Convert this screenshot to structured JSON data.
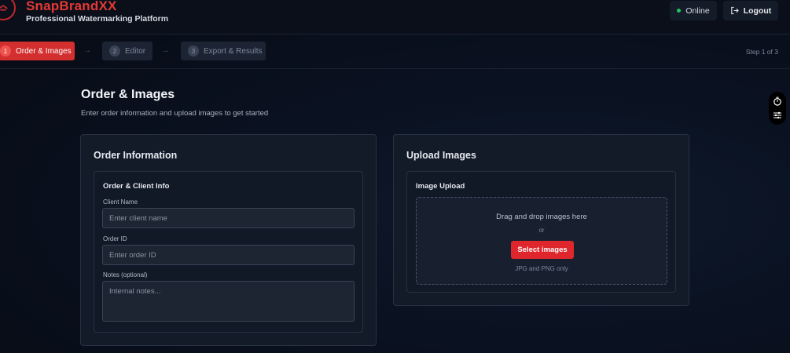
{
  "brand": {
    "title": "SnapBrandXX",
    "subtitle": "Professional Watermarking Platform"
  },
  "header": {
    "status_label": "Online",
    "logout_label": "Logout"
  },
  "stepper": {
    "steps": [
      {
        "number": "1",
        "label": "Order & Images",
        "active": true
      },
      {
        "number": "2",
        "label": "Editor",
        "active": false
      },
      {
        "number": "3",
        "label": "Export & Results",
        "active": false
      }
    ],
    "arrow": "→",
    "progress_text": "Step 1 of 3"
  },
  "page": {
    "title": "Order & Images",
    "subtitle": "Enter order information and upload images to get started"
  },
  "order_card": {
    "title": "Order Information",
    "section_title": "Order & Client Info",
    "fields": {
      "client_name": {
        "label": "Client Name",
        "placeholder": "Enter client name",
        "value": ""
      },
      "order_id": {
        "label": "Order ID",
        "placeholder": "Enter order ID",
        "value": ""
      },
      "notes": {
        "label": "Notes (optional)",
        "placeholder": "Internal notes...",
        "value": ""
      }
    }
  },
  "upload_card": {
    "title": "Upload Images",
    "section_title": "Image Upload",
    "drop_text": "Drag and drop images here",
    "or_text": "or",
    "select_button": "Select images",
    "format_note": "JPG and PNG only"
  },
  "colors": {
    "accent": "#e0262d",
    "online": "#22c55e",
    "background": "#0a1120",
    "card": "#131b29"
  },
  "icons": {
    "logo": "stamp-icon",
    "logout": "logout-icon",
    "side_tool": [
      "timer-icon",
      "sliders-icon"
    ]
  }
}
